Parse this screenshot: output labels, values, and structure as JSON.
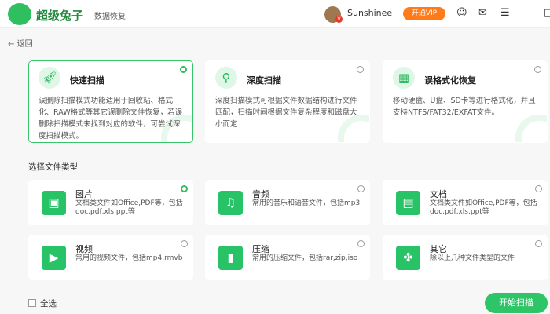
{
  "header": {
    "brand": "超级兔子",
    "product": "数据恢复",
    "username": "Sunshinee",
    "vip_badge": "V",
    "vip_button": "开通VIP"
  },
  "back": "返回",
  "modes": [
    {
      "title": "快速扫描",
      "desc": "误删除扫描模式功能适用于回收站、格式化、RAW格式等其它误删除文件恢复，若误删除扫描模式未找到对应的软件，可尝试深度扫描模式。",
      "selected": true
    },
    {
      "title": "深度扫描",
      "desc": "深度扫描模式可根据文件数据结构进行文件匹配，扫描时间根据文件复杂程度和磁盘大小而定",
      "selected": false
    },
    {
      "title": "误格式化恢复",
      "desc": "移动硬盘、U盘、SD卡等进行格式化，并且支持NTFS/FAT32/EXFAT文件。",
      "selected": false
    }
  ],
  "section_title": "选择文件类型",
  "file_types": [
    {
      "title": "图片",
      "desc": "文档类文件如Office,PDF等，包括doc,pdf,xls,ppt等",
      "selected": true
    },
    {
      "title": "音频",
      "desc": "常用的音乐和语音文件，包括mp3",
      "selected": false
    },
    {
      "title": "文档",
      "desc": "文档类文件如Office,PDF等，包括doc,pdf,xls,ppt等",
      "selected": false
    },
    {
      "title": "视频",
      "desc": "常用的视频文件，包括mp4,rmvb",
      "selected": false
    },
    {
      "title": "压缩",
      "desc": "常用的压缩文件，包括rar,zip,iso",
      "selected": false
    },
    {
      "title": "其它",
      "desc": "除以上几种文件类型的文件",
      "selected": false
    }
  ],
  "select_all": "全选",
  "start_button": "开始扫描",
  "accent": "#2ec468"
}
